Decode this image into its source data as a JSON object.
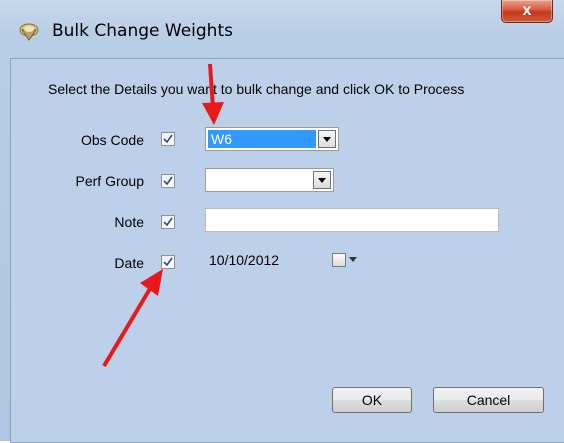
{
  "window": {
    "title": "Bulk Change Weights",
    "close_label": "x"
  },
  "form": {
    "instruction": "Select the Details you want to bulk change and click OK to Process",
    "fields": [
      {
        "label": "Obs Code",
        "checked": true,
        "type": "combo",
        "value": "W6"
      },
      {
        "label": "Perf Group",
        "checked": true,
        "type": "combo",
        "value": ""
      },
      {
        "label": "Note",
        "checked": true,
        "type": "text",
        "value": ""
      },
      {
        "label": "Date",
        "checked": true,
        "type": "date",
        "value": "10/10/2012"
      }
    ]
  },
  "buttons": {
    "ok_label": "OK",
    "cancel_label": "Cancel"
  },
  "annotations": {
    "arrow_color": "#e8191b"
  },
  "icons": {
    "app": "spinning-top-icon",
    "dropdown": "chevron-down-icon",
    "calendar": "calendar-icon"
  }
}
